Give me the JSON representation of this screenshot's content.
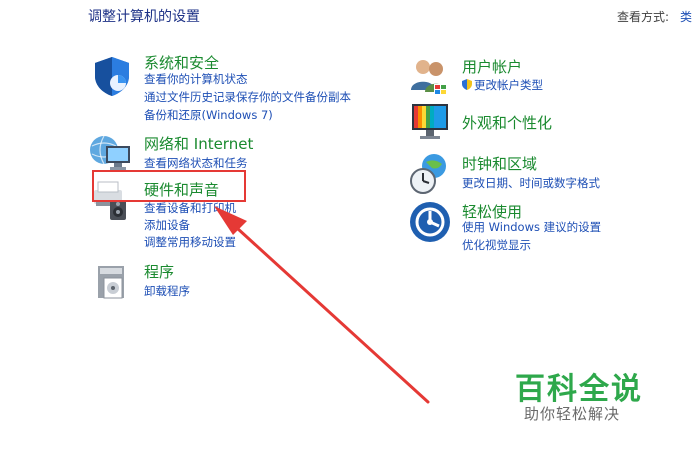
{
  "header": {
    "title": "调整计算机的设置",
    "view_label": "查看方式:",
    "view_value": "类"
  },
  "left_categories": [
    {
      "title": "系统和安全",
      "icon": "shield-icon",
      "links": [
        "查看你的计算机状态",
        "通过文件历史记录保存你的文件备份副本",
        "备份和还原(Windows 7)"
      ]
    },
    {
      "title": "网络和 Internet",
      "icon": "network-globe-icon",
      "links": [
        "查看网络状态和任务"
      ]
    },
    {
      "title": "硬件和声音",
      "icon": "printer-speaker-icon",
      "links": [
        "查看设备和打印机",
        "添加设备",
        "调整常用移动设置"
      ]
    },
    {
      "title": "程序",
      "icon": "programs-icon",
      "links": [
        "卸载程序"
      ]
    }
  ],
  "right_categories": [
    {
      "title": "用户帐户",
      "icon": "users-icon",
      "links": [
        "更改帐户类型"
      ]
    },
    {
      "title": "外观和个性化",
      "icon": "monitor-icon",
      "links": []
    },
    {
      "title": "时钟和区域",
      "icon": "clock-globe-icon",
      "links": [
        "更改日期、时间或数字格式"
      ]
    },
    {
      "title": "轻松使用",
      "icon": "ease-of-access-icon",
      "links": [
        "使用 Windows 建议的设置",
        "优化视觉显示"
      ]
    }
  ],
  "watermark": {
    "title": "百科全说",
    "subtitle": "助你轻松解决"
  },
  "colors": {
    "category_title": "#1a8a2f",
    "link": "#1e4fb5",
    "page_title": "#1e3287",
    "highlight": "#e53935",
    "watermark": "#2ea84b"
  }
}
